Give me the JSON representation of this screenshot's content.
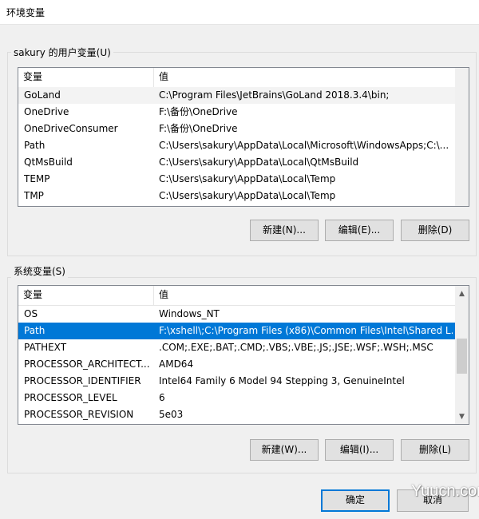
{
  "window": {
    "title": "环境变量"
  },
  "user_vars": {
    "group_label": "sakury 的用户变量(U)",
    "columns": [
      "变量",
      "值"
    ],
    "rows": [
      {
        "name": "GoLand",
        "value": "C:\\Program Files\\JetBrains\\GoLand 2018.3.4\\bin;"
      },
      {
        "name": "OneDrive",
        "value": "F:\\备份\\OneDrive"
      },
      {
        "name": "OneDriveConsumer",
        "value": "F:\\备份\\OneDrive"
      },
      {
        "name": "Path",
        "value": "C:\\Users\\sakury\\AppData\\Local\\Microsoft\\WindowsApps;C:\\..."
      },
      {
        "name": "QtMsBuild",
        "value": "C:\\Users\\sakury\\AppData\\Local\\QtMsBuild"
      },
      {
        "name": "TEMP",
        "value": "C:\\Users\\sakury\\AppData\\Local\\Temp"
      },
      {
        "name": "TMP",
        "value": "C:\\Users\\sakury\\AppData\\Local\\Temp"
      }
    ],
    "buttons": {
      "new": "新建(N)...",
      "edit": "编辑(E)...",
      "delete": "删除(D)"
    }
  },
  "system_vars": {
    "group_label": "系统变量(S)",
    "columns": [
      "变量",
      "值"
    ],
    "rows": [
      {
        "name": "OS",
        "value": "Windows_NT"
      },
      {
        "name": "Path",
        "value": "F:\\xshell\\;C:\\Program Files (x86)\\Common Files\\Intel\\Shared L..."
      },
      {
        "name": "PATHEXT",
        "value": ".COM;.EXE;.BAT;.CMD;.VBS;.VBE;.JS;.JSE;.WSF;.WSH;.MSC"
      },
      {
        "name": "PROCESSOR_ARCHITECT...",
        "value": "AMD64"
      },
      {
        "name": "PROCESSOR_IDENTIFIER",
        "value": "Intel64 Family 6 Model 94 Stepping 3, GenuineIntel"
      },
      {
        "name": "PROCESSOR_LEVEL",
        "value": "6"
      },
      {
        "name": "PROCESSOR_REVISION",
        "value": "5e03"
      }
    ],
    "selected_row": "Path",
    "buttons": {
      "new": "新建(W)...",
      "edit": "编辑(I)...",
      "delete": "删除(L)"
    }
  },
  "footer": {
    "ok": "确定",
    "cancel": "取消"
  },
  "watermark": "Yuucn.com",
  "colors": {
    "selection": "#0078d7",
    "default_button_border": "#0078d7"
  }
}
